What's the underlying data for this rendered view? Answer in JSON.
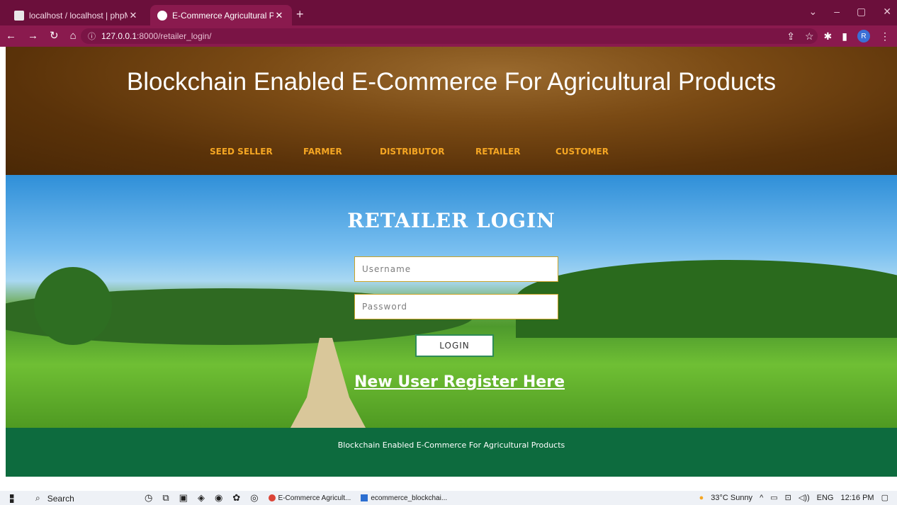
{
  "browser": {
    "tabs": [
      {
        "title": "localhost / localhost | phpMyAdm",
        "close": "✕"
      },
      {
        "title": "E-Commerce Agricultural Produc",
        "close": "✕"
      }
    ],
    "new_tab": "+",
    "url_host": "127.0.0.1",
    "url_path": ":8000/retailer_login/",
    "avatar": "R"
  },
  "site": {
    "title": "Blockchain Enabled E-Commerce For Agricultural Products",
    "menu": [
      "SEED SELLER",
      "FARMER",
      "DISTRIBUTOR",
      "RETAILER",
      "CUSTOMER"
    ]
  },
  "login": {
    "heading": "RETAILER LOGIN",
    "username_placeholder": "Username",
    "password_placeholder": "Password",
    "button": "LOGIN",
    "register_link": "New User Register Here"
  },
  "footer": {
    "text": "Blockchain Enabled E-Commerce For Agricultural Products"
  },
  "taskbar": {
    "search": "Search",
    "items": [
      "E-Commerce Agricult...",
      "ecommerce_blockchai..."
    ],
    "weather": "33°C  Sunny",
    "lang": "ENG",
    "time": "12:16 PM"
  },
  "colors": {
    "header_brown": "#5a3209",
    "menu_orange": "#f5a623",
    "footer_green": "#0d6b3e",
    "chrome": "#8a1a4e"
  }
}
